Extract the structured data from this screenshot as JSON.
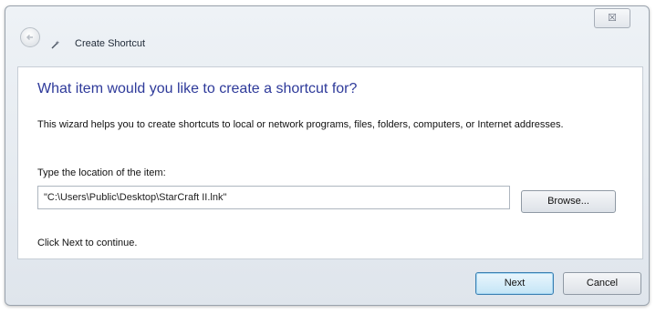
{
  "window": {
    "title": "Create Shortcut",
    "close_label": "☒"
  },
  "icons": {
    "back": "back-arrow-icon",
    "wizard": "wizard-icon"
  },
  "wizard": {
    "heading": "What item would you like to create a shortcut for?",
    "description": "This wizard helps you to create shortcuts to local or network programs, files, folders, computers, or Internet addresses.",
    "location_label": "Type the location of the item:",
    "location_value": "\"C:\\Users\\Public\\Desktop\\StarCraft II.lnk\"",
    "browse_label": "Browse...",
    "continue_text": "Click Next to continue."
  },
  "buttons": {
    "next_label": "Next",
    "cancel_label": "Cancel"
  },
  "colors": {
    "heading": "#2e3a9a",
    "default_button_border": "#3c7fb1",
    "frame_background": "#dfe5ec"
  }
}
